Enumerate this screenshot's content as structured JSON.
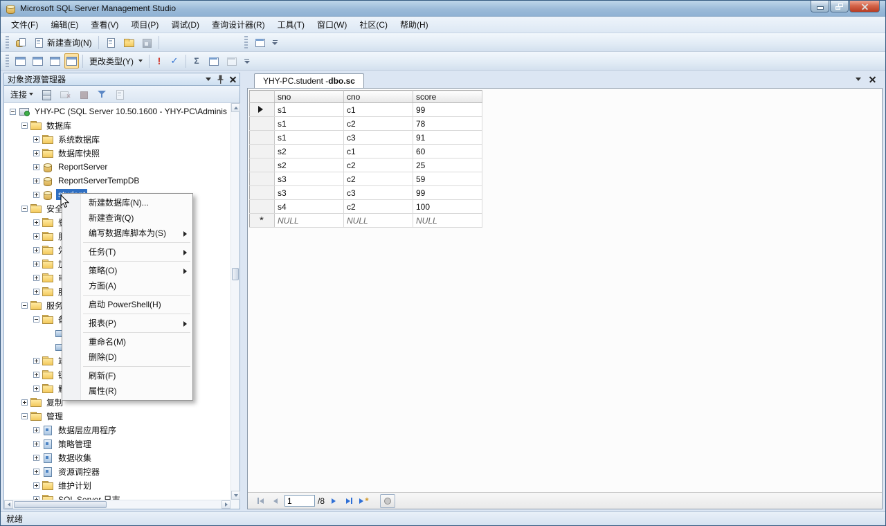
{
  "window": {
    "title": "Microsoft SQL Server Management Studio"
  },
  "menu_bar": {
    "items": [
      "文件(F)",
      "编辑(E)",
      "查看(V)",
      "项目(P)",
      "调试(D)",
      "查询设计器(R)",
      "工具(T)",
      "窗口(W)",
      "社区(C)",
      "帮助(H)"
    ]
  },
  "toolbars": {
    "standard": {
      "new_query": "新建查询(N)"
    },
    "designer": {
      "change_type": "更改类型(Y)"
    }
  },
  "object_explorer": {
    "title": "对象资源管理器",
    "connect": "连接",
    "tree": [
      {
        "label": "YHY-PC (SQL Server 10.50.1600 - YHY-PC\\Adminis",
        "level": 0,
        "expand": "minus",
        "icon": "server"
      },
      {
        "label": "数据库",
        "level": 1,
        "expand": "minus",
        "icon": "folder"
      },
      {
        "label": "系统数据库",
        "level": 2,
        "expand": "plus",
        "icon": "folder"
      },
      {
        "label": "数据库快照",
        "level": 2,
        "expand": "plus",
        "icon": "folder"
      },
      {
        "label": "ReportServer",
        "level": 2,
        "expand": "plus",
        "icon": "db"
      },
      {
        "label": "ReportServerTempDB",
        "level": 2,
        "expand": "plus",
        "icon": "db"
      },
      {
        "label": "student",
        "level": 2,
        "expand": "plus",
        "icon": "db",
        "selected": true
      },
      {
        "label": "安全性",
        "level": 1,
        "expand": "minus",
        "icon": "folder"
      },
      {
        "label": "登录名",
        "level": 2,
        "expand": "plus",
        "icon": "folder"
      },
      {
        "label": "服务器角色",
        "level": 2,
        "expand": "plus",
        "icon": "folder"
      },
      {
        "label": "凭据",
        "level": 2,
        "expand": "plus",
        "icon": "folder"
      },
      {
        "label": "加密提供程序",
        "level": 2,
        "expand": "plus",
        "icon": "folder"
      },
      {
        "label": "审核",
        "level": 2,
        "expand": "plus",
        "icon": "folder"
      },
      {
        "label": "服务器审核规范",
        "level": 2,
        "expand": "plus",
        "icon": "folder"
      },
      {
        "label": "服务器对象",
        "level": 1,
        "expand": "minus",
        "icon": "folder"
      },
      {
        "label": "备份设备",
        "level": 2,
        "expand": "minus",
        "icon": "folder"
      },
      {
        "label": "",
        "level": 3,
        "expand": "none",
        "icon": "device"
      },
      {
        "label": "",
        "level": 3,
        "expand": "none",
        "icon": "device"
      },
      {
        "label": "端点",
        "level": 2,
        "expand": "plus",
        "icon": "folder"
      },
      {
        "label": "链接服务器",
        "level": 2,
        "expand": "plus",
        "icon": "folder"
      },
      {
        "label": "触发器",
        "level": 2,
        "expand": "plus",
        "icon": "folder"
      },
      {
        "label": "复制",
        "level": 1,
        "expand": "plus",
        "icon": "folder"
      },
      {
        "label": "管理",
        "level": 1,
        "expand": "minus",
        "icon": "folder"
      },
      {
        "label": "数据层应用程序",
        "level": 2,
        "expand": "plus",
        "icon": "item"
      },
      {
        "label": "策略管理",
        "level": 2,
        "expand": "plus",
        "icon": "item"
      },
      {
        "label": "数据收集",
        "level": 2,
        "expand": "plus",
        "icon": "item"
      },
      {
        "label": "资源调控器",
        "level": 2,
        "expand": "plus",
        "icon": "item"
      },
      {
        "label": "维护计划",
        "level": 2,
        "expand": "plus",
        "icon": "folder"
      },
      {
        "label": "SQL Server 日志",
        "level": 2,
        "expand": "plus",
        "icon": "folder"
      }
    ]
  },
  "context_menu": {
    "items": [
      {
        "label": "新建数据库(N)..."
      },
      {
        "label": "新建查询(Q)"
      },
      {
        "label": "编写数据库脚本为(S)",
        "submenu": true,
        "sep_after": true
      },
      {
        "label": "任务(T)",
        "submenu": true,
        "sep_after": true
      },
      {
        "label": "策略(O)",
        "submenu": true
      },
      {
        "label": "方面(A)",
        "sep_after": true
      },
      {
        "label": "启动 PowerShell(H)",
        "sep_after": true
      },
      {
        "label": "报表(P)",
        "submenu": true,
        "sep_after": true
      },
      {
        "label": "重命名(M)"
      },
      {
        "label": "删除(D)",
        "sep_after": true
      },
      {
        "label": "刷新(F)"
      },
      {
        "label": "属性(R)"
      }
    ]
  },
  "document": {
    "tab": {
      "prefix": "YHY-PC.student - ",
      "bold": "dbo.sc"
    },
    "grid": {
      "columns": [
        "sno",
        "cno",
        "score"
      ],
      "rows": [
        [
          "s1",
          "c1",
          "99"
        ],
        [
          "s1",
          "c2",
          "78"
        ],
        [
          "s1",
          "c3",
          "91"
        ],
        [
          "s2",
          "c1",
          "60"
        ],
        [
          "s2",
          "c2",
          "25"
        ],
        [
          "s3",
          "c2",
          "59"
        ],
        [
          "s3",
          "c3",
          "99"
        ],
        [
          "s4",
          "c2",
          "100"
        ]
      ],
      "new_row": [
        "NULL",
        "NULL",
        "NULL"
      ]
    },
    "navigator": {
      "current": "1",
      "of": "/8"
    }
  },
  "status_bar": {
    "text": "就绪"
  }
}
